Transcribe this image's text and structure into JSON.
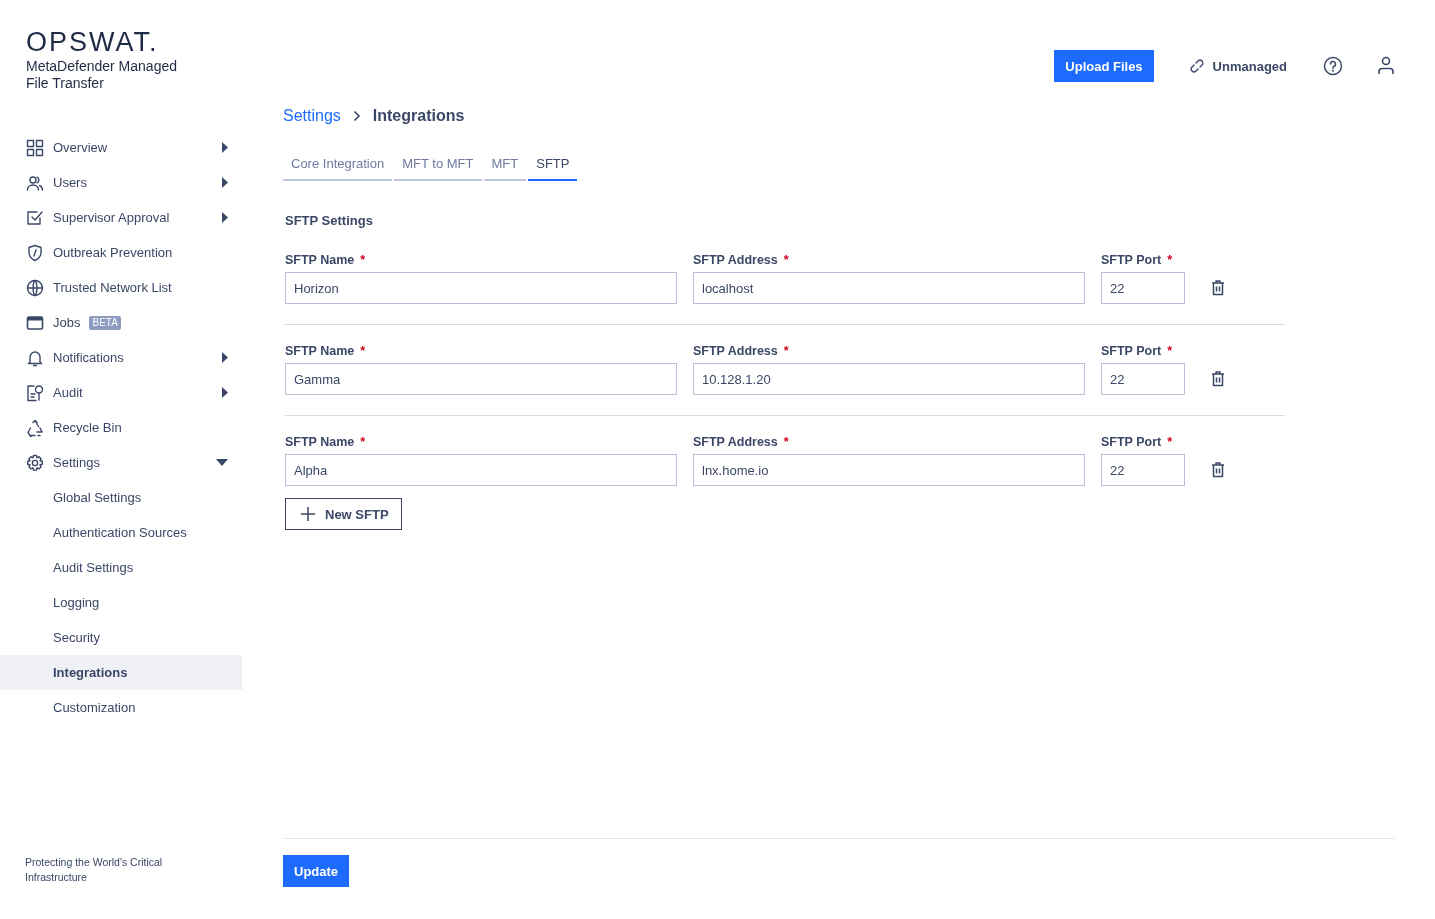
{
  "sidebar": {
    "logo": "OPSWAT.",
    "product": "MetaDefender Managed File Transfer",
    "nav": [
      {
        "label": "Overview",
        "expanded": false,
        "selected": false
      },
      {
        "label": "Users",
        "expanded": false,
        "selected": false
      },
      {
        "label": "Supervisor Approval",
        "expanded": false,
        "selected": false
      },
      {
        "label": "Outbreak Prevention",
        "selected": false
      },
      {
        "label": "Trusted Network List",
        "selected": false
      },
      {
        "label": "Jobs",
        "badge": "BETA",
        "selected": false
      },
      {
        "label": "Notifications",
        "expanded": false,
        "selected": false
      },
      {
        "label": "Audit",
        "expanded": false,
        "selected": false
      },
      {
        "label": "Recycle Bin",
        "selected": false
      },
      {
        "label": "Settings",
        "expanded": true,
        "selected": false,
        "children": [
          {
            "label": "Global Settings",
            "selected": false
          },
          {
            "label": "Authentication Sources",
            "selected": false
          },
          {
            "label": "Audit Settings",
            "selected": false
          },
          {
            "label": "Logging",
            "selected": false
          },
          {
            "label": "Security",
            "selected": false
          },
          {
            "label": "Integrations",
            "selected": true
          },
          {
            "label": "Customization",
            "selected": false
          }
        ]
      }
    ],
    "tagline": "Protecting the World's Critical Infrastructure"
  },
  "header": {
    "upload_button": "Upload Files",
    "status": "Unmanaged"
  },
  "breadcrumb": [
    {
      "label": "Settings",
      "link": true
    },
    {
      "label": "Integrations",
      "link": false
    }
  ],
  "tabs": [
    {
      "label": "Core Integration",
      "selected": false
    },
    {
      "label": "MFT to MFT",
      "selected": false
    },
    {
      "label": "MFT",
      "selected": false
    },
    {
      "label": "SFTP",
      "selected": true
    }
  ],
  "section_title": "SFTP Settings",
  "sftp_rows": [
    {
      "fields": [
        {
          "label": "SFTP Name",
          "required_mark": "*",
          "value": "Horizon"
        },
        {
          "label": "SFTP Address",
          "required_mark": "*",
          "value": "localhost"
        },
        {
          "label": "SFTP Port",
          "required_mark": "*",
          "value": "22"
        }
      ]
    },
    {
      "fields": [
        {
          "label": "SFTP Name",
          "required_mark": "*",
          "value": "Gamma"
        },
        {
          "label": "SFTP Address",
          "required_mark": "*",
          "value": "10.128.1.20"
        },
        {
          "label": "SFTP Port",
          "required_mark": "*",
          "value": "22"
        }
      ]
    },
    {
      "fields": [
        {
          "label": "SFTP Name",
          "required_mark": "*",
          "value": "Alpha"
        },
        {
          "label": "SFTP Address",
          "required_mark": "*",
          "value": "lnx.home.io"
        },
        {
          "label": "SFTP Port",
          "required_mark": "*",
          "value": "22"
        }
      ]
    }
  ],
  "new_button": "New SFTP",
  "update_button": "Update"
}
